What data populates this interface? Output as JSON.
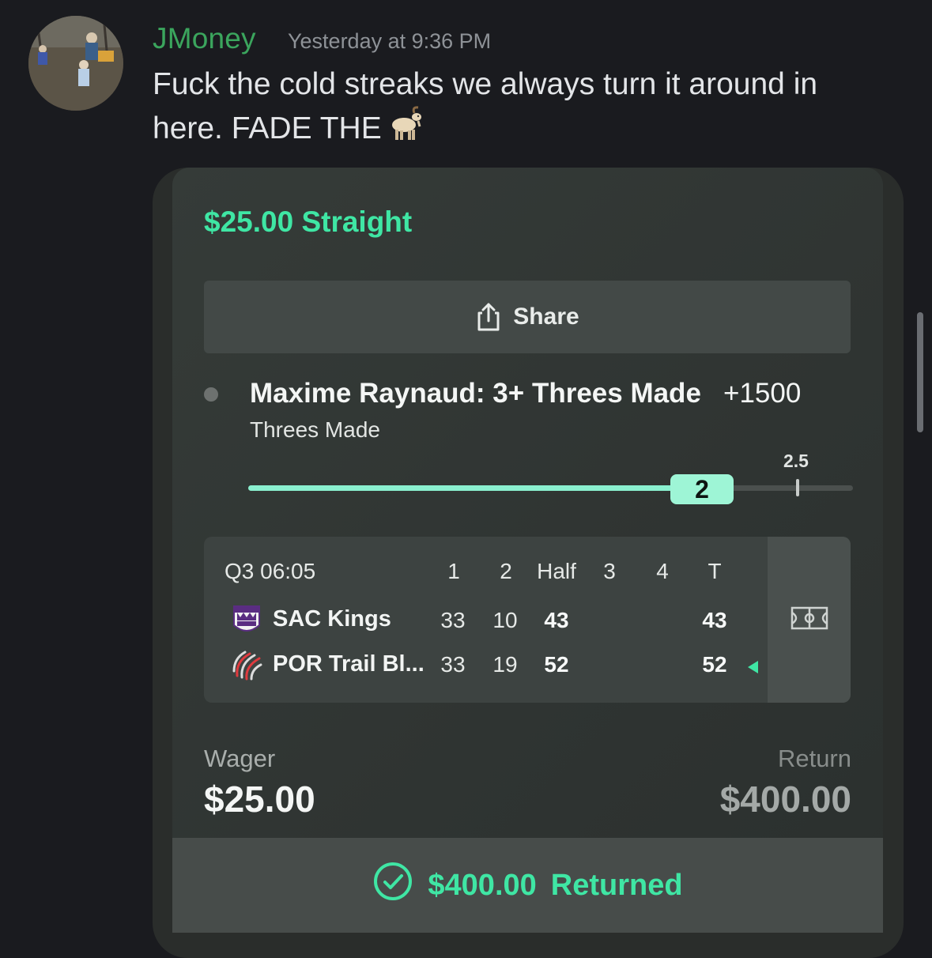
{
  "message": {
    "username": "JMoney",
    "timestamp": "Yesterday at 9:36 PM",
    "text": "Fuck the cold streaks we always turn it around in here. FADE THE",
    "emoji": "goat-emoji"
  },
  "bet": {
    "title": "$25.00 Straight",
    "share_label": "Share",
    "prop_title": "Maxime Raynaud: 3+ Threes Made",
    "odds": "+1500",
    "prop_subtitle": "Threes Made",
    "line_label": "2.5",
    "progress_value": "2",
    "progress_fraction": 0.72,
    "scoreboard": {
      "clock": "Q3 06:05",
      "headers": [
        "1",
        "2",
        "Half",
        "3",
        "4",
        "T"
      ],
      "teams": [
        {
          "name": "SAC Kings",
          "q1": "33",
          "q2": "10",
          "half": "43",
          "q3": "",
          "q4": "",
          "total": "43",
          "logo": "kings-logo"
        },
        {
          "name": "POR Trail Bl...",
          "q1": "33",
          "q2": "19",
          "half": "52",
          "q3": "",
          "q4": "",
          "total": "52",
          "logo": "trail-blazers-logo"
        }
      ],
      "court_icon": "court-icon"
    },
    "wager_label": "Wager",
    "wager_value": "$25.00",
    "return_label": "Return",
    "return_value": "$400.00",
    "returned_amount": "$400.00",
    "returned_label": "Returned"
  },
  "colors": {
    "username": "#3ba55d",
    "accent_green": "#3fe6a4",
    "background": "#1a1b1f"
  }
}
